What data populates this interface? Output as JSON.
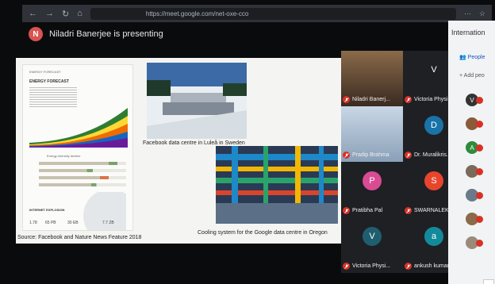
{
  "browser": {
    "url": "https://meet.google.com/net-oxe-cco",
    "menu_glyph": "···",
    "star_glyph": "☆"
  },
  "presenter": {
    "initial": "N",
    "text": "Niladri Banerjee is presenting",
    "avatar_color": "#d9534f"
  },
  "slide": {
    "caption_lulea": "Facebook data centre in Luleå in Sweden",
    "caption_oregon": "Cooling system for the Google data centre in Oregon",
    "source": "Source: Facebook and Nature News Feature 2018",
    "infographic": {
      "title": "ENERGY FORECAST",
      "heading": "ENERGY FORECAST",
      "section": "Energy-intensity decline",
      "internet": "INTERNET EXPLOSION",
      "values": [
        "1.78",
        "65 PB",
        "30 EB",
        "7.7 ZB"
      ]
    }
  },
  "participants": [
    {
      "name": "Niladri Banerj...",
      "initial": "",
      "color": "",
      "type": "video"
    },
    {
      "name": "Victoria Physi...",
      "initial": "V",
      "color": "#1e2024",
      "type": "avatar"
    },
    {
      "name": "Pradip Brahma",
      "initial": "",
      "color": "",
      "type": "video"
    },
    {
      "name": "Dr. Muralikris...",
      "initial": "D",
      "color": "#1a73a8",
      "type": "avatar"
    },
    {
      "name": "Pratibha Pal",
      "initial": "P",
      "color": "#d94b93",
      "type": "avatar"
    },
    {
      "name": "SWARNALEK...",
      "initial": "S",
      "color": "#e8452c",
      "type": "avatar"
    },
    {
      "name": "Victoria Physi...",
      "initial": "V",
      "color": "#1f5e6e",
      "type": "avatar"
    },
    {
      "name": "ankush kumar",
      "initial": "a",
      "color": "#138a9c",
      "type": "avatar"
    }
  ],
  "panel": {
    "title": "Internation",
    "people_tab": "People",
    "add_people": "Add peo",
    "list": [
      {
        "initial": "V",
        "color": "#333"
      },
      {
        "initial": "",
        "color": "#8a5a3a"
      },
      {
        "initial": "A",
        "color": "#2e8b3a"
      },
      {
        "initial": "",
        "color": "#7a6a5a"
      },
      {
        "initial": "",
        "color": "#6a7a8a"
      },
      {
        "initial": "",
        "color": "#8a6a4a"
      },
      {
        "initial": "",
        "color": "#9a8a7a"
      }
    ]
  }
}
